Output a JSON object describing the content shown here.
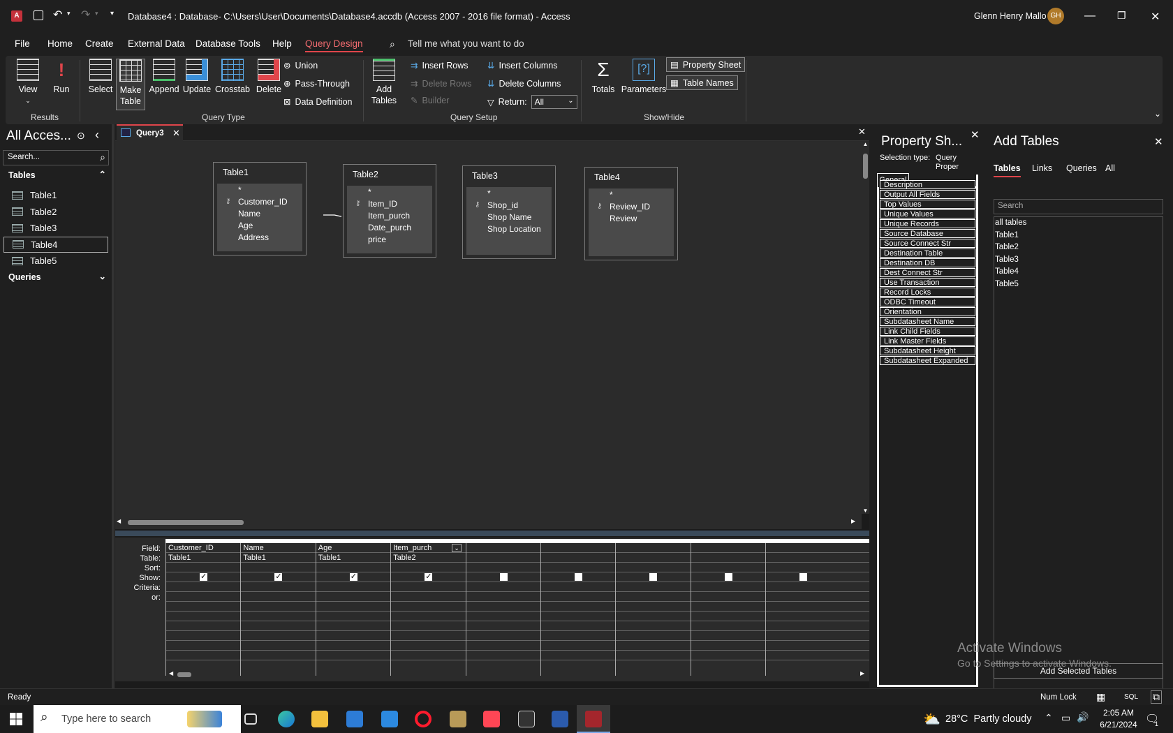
{
  "window": {
    "title": "Database4 : Database- C:\\Users\\User\\Documents\\Database4.accdb (Access 2007 - 2016 file format)  -  Access",
    "user": "Glenn Henry Mallo",
    "initials": "GH"
  },
  "menu": {
    "file": "File",
    "home": "Home",
    "create": "Create",
    "external": "External Data",
    "dbtools": "Database Tools",
    "help": "Help",
    "query_design": "Query Design",
    "tell_me": "Tell me what you want to do"
  },
  "ribbon": {
    "results": {
      "view": "View",
      "run": "Run",
      "label": "Results"
    },
    "query_type": {
      "select": "Select",
      "make_table": "Make Table",
      "append": "Append",
      "update": "Update",
      "crosstab": "Crosstab",
      "delete": "Delete",
      "union": "Union",
      "passthrough": "Pass-Through",
      "data_def": "Data Definition",
      "label": "Query Type"
    },
    "query_setup": {
      "add_tables": "Add Tables",
      "insert_rows": "Insert Rows",
      "delete_rows": "Delete Rows",
      "builder": "Builder",
      "insert_columns": "Insert Columns",
      "delete_columns": "Delete Columns",
      "return_label": "Return:",
      "return_value": "All",
      "label": "Query Setup"
    },
    "show_hide": {
      "totals": "Totals",
      "parameters": "Parameters",
      "property_sheet": "Property Sheet",
      "table_names": "Table Names",
      "label": "Show/Hide"
    }
  },
  "nav": {
    "title": "All Acces...",
    "search": "Search...",
    "tables_header": "Tables",
    "tables": [
      "Table1",
      "Table2",
      "Table3",
      "Table4",
      "Table5"
    ],
    "queries_header": "Queries"
  },
  "doc_tab": {
    "label": "Query3"
  },
  "tables": [
    {
      "name": "Table1",
      "fields": [
        "*",
        "Customer_ID",
        "Name",
        "Age",
        "Address"
      ],
      "key_index": 1
    },
    {
      "name": "Table2",
      "fields": [
        "*",
        "Item_ID",
        "Item_purch",
        "Date_purch",
        "price"
      ],
      "key_index": 1
    },
    {
      "name": "Table3",
      "fields": [
        "*",
        "Shop_id",
        "Shop Name",
        "Shop Location"
      ],
      "key_index": 1
    },
    {
      "name": "Table4",
      "fields": [
        "*",
        "Review_ID",
        "Review"
      ],
      "key_index": 1
    }
  ],
  "grid": {
    "row_labels": [
      "Field:",
      "Table:",
      "Sort:",
      "Show:",
      "Criteria:",
      "or:"
    ],
    "columns": [
      {
        "field": "Customer_ID",
        "table": "Table1",
        "show": true
      },
      {
        "field": "Name",
        "table": "Table1",
        "show": true
      },
      {
        "field": "Age",
        "table": "Table1",
        "show": true
      },
      {
        "field": "Item_purch",
        "table": "Table2",
        "show": true
      },
      {
        "field": "",
        "table": "",
        "show": false
      },
      {
        "field": "",
        "table": "",
        "show": false
      },
      {
        "field": "",
        "table": "",
        "show": false
      },
      {
        "field": "",
        "table": "",
        "show": false
      },
      {
        "field": "",
        "table": "",
        "show": false
      }
    ]
  },
  "property_sheet": {
    "title": "Property Sh...",
    "selection_label": "Selection type:",
    "selection_value": "Query Proper",
    "tab": "General",
    "items": [
      "Description",
      "Output All Fields",
      "Top Values",
      "Unique Values",
      "Unique Records",
      "Source Database",
      "Source Connect Str",
      "Destination Table",
      "Destination DB",
      "Dest Connect Str",
      "Use Transaction",
      "Record Locks",
      "ODBC Timeout",
      "Orientation",
      "Subdatasheet Name",
      "Link Child Fields",
      "Link Master Fields",
      "Subdatasheet Height",
      "Subdatasheet Expanded"
    ]
  },
  "add_tables": {
    "title": "Add Tables",
    "tabs": [
      "Tables",
      "Links",
      "Queries",
      "All"
    ],
    "search_placeholder": "Search",
    "items": [
      "all tables",
      "Table1",
      "Table2",
      "Table3",
      "Table4",
      "Table5"
    ],
    "button": "Add Selected Tables"
  },
  "watermark": {
    "line1": "Activate Windows",
    "line2": "Go to Settings to activate Windows."
  },
  "status": {
    "left": "Ready",
    "numlock": "Num Lock",
    "sql": "SQL"
  },
  "taskbar": {
    "search": "Type here to search",
    "weather": "28°C  Partly cloudy",
    "time": "2:05 AM",
    "date": "6/21/2024",
    "notif": "1"
  },
  "colors": {
    "accent": "#e0454b",
    "access_red": "#a4262c",
    "bg": "#1f1f1f",
    "panel": "#2b2b2b"
  }
}
